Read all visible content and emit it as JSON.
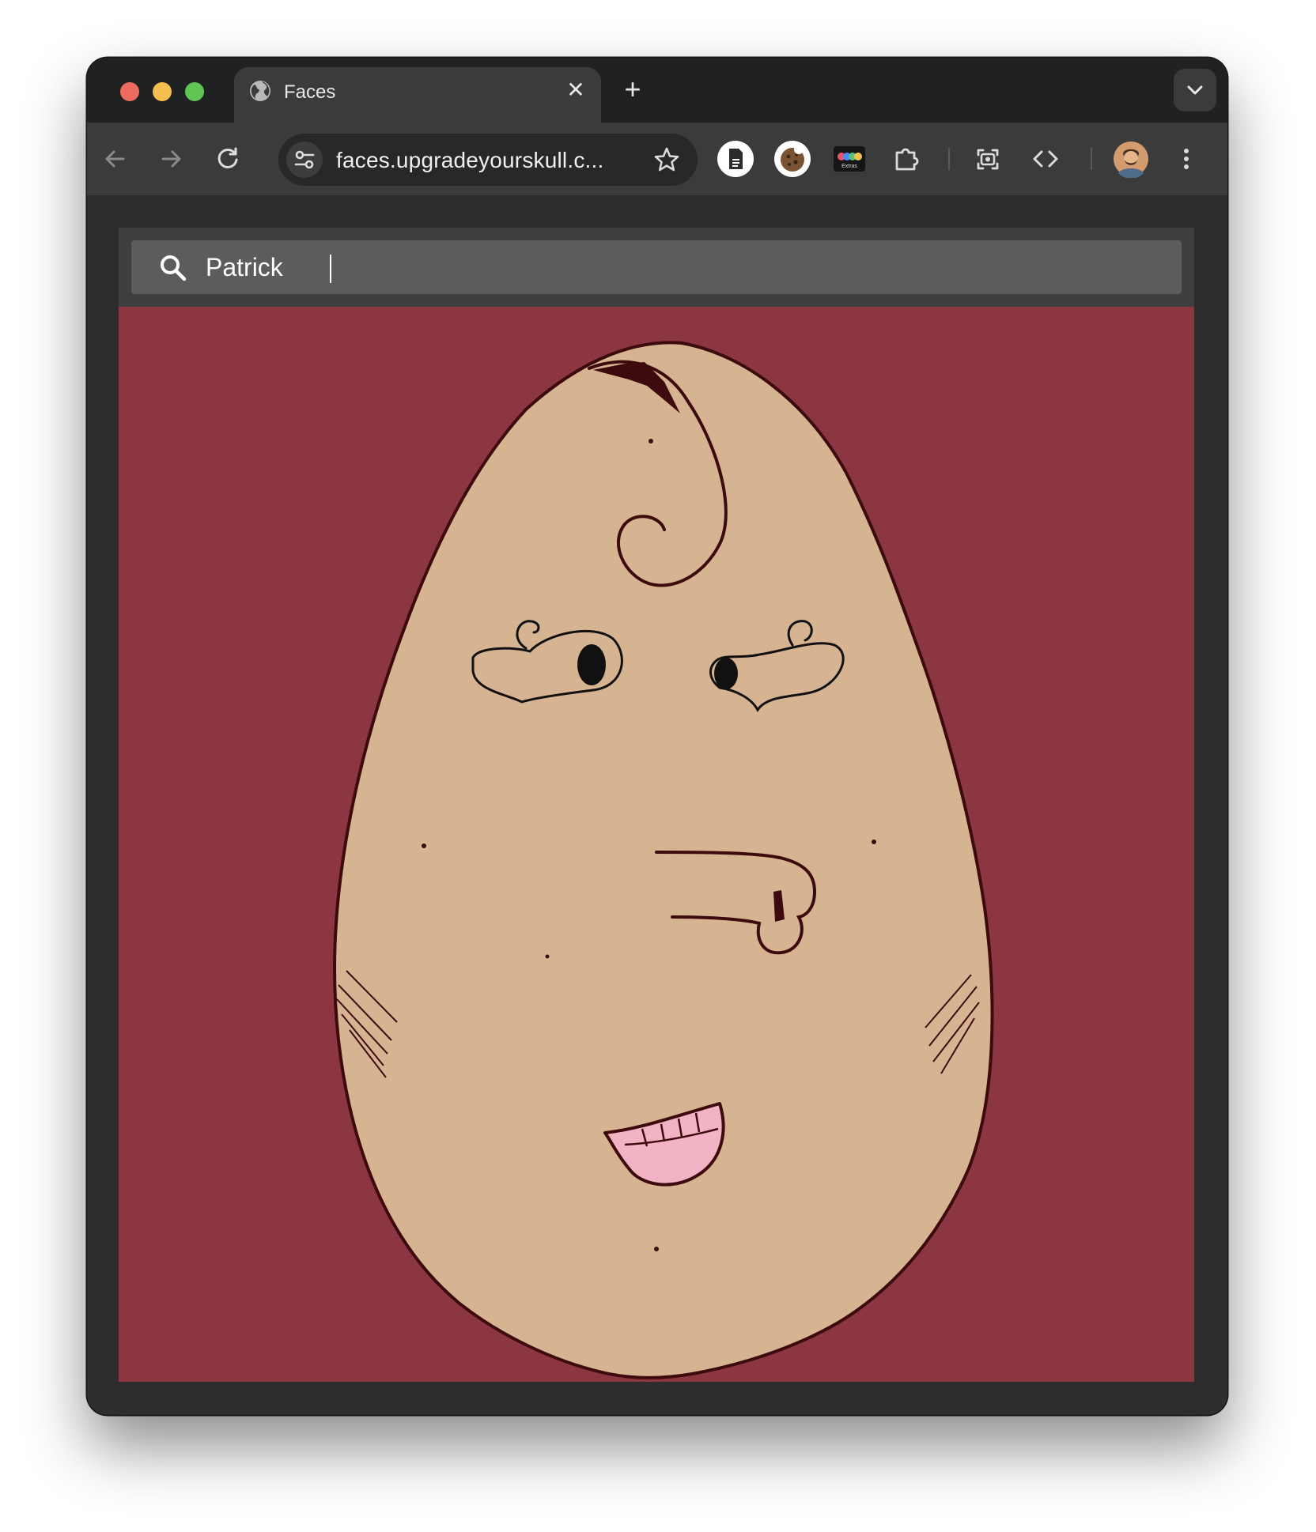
{
  "browser": {
    "tab": {
      "title": "Faces",
      "close_glyph": "✕"
    },
    "new_tab_glyph": "+",
    "address_bar": {
      "url": "faces.upgradeyourskull.c..."
    },
    "icons": {
      "tab_favicon": "globe-icon",
      "back": "arrow-left-icon",
      "forward": "arrow-right-icon",
      "reload": "reload-icon",
      "site_settings": "tune-icon",
      "bookmark": "star-icon",
      "extension_1": "document-extension-icon",
      "extension_2": "cookie-extension-icon",
      "extension_3": "extras-extension-icon",
      "extensions_menu": "puzzle-icon",
      "screenshot": "screenshot-icon",
      "devtools": "code-icon",
      "profile": "avatar",
      "menu": "kebab-menu-icon",
      "tab_search": "chevron-down-icon"
    },
    "extras_label": "Extras"
  },
  "page": {
    "search": {
      "value": "Patrick",
      "icon": "search-icon"
    },
    "face": {
      "background_color": "#8b3640",
      "skin_color": "#d7b491",
      "line_color": "#3d0a0d",
      "mouth_color": "#f2b3c5"
    }
  }
}
